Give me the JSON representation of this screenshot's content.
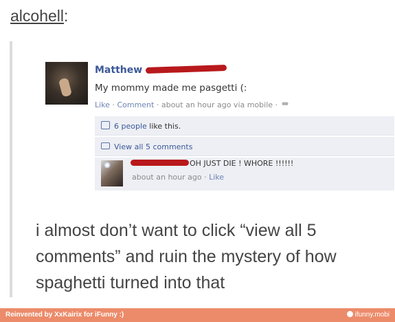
{
  "tumblr": {
    "username": "alcohell",
    "colon": ":"
  },
  "fb_post": {
    "poster_name": "Matthew",
    "status": "My mommy made me pasgetti (:",
    "meta": {
      "like": "Like",
      "sep1": " · ",
      "comment": "Comment",
      "sep2": " · ",
      "time": "about an hour ago via mobile",
      "sep3": " · "
    },
    "likes": {
      "people_link": "6 people",
      "suffix": " like this."
    },
    "view_all": "View all 5 comments",
    "comment": {
      "text": "OH JUST DIE ! WHORE !!!!!!",
      "time": "about an hour ago",
      "sep": " · ",
      "like": "Like"
    }
  },
  "caption": "i almost don’t want to click “view all 5 comments” and ruin the mystery of how spaghetti turned into that",
  "footer": {
    "left": "Reinvented by XxKairix for iFunny :)",
    "right": "ifunny.mobi"
  },
  "colors": {
    "fb_blue": "#3b5998",
    "fb_box": "#edeff4",
    "redaction": "#b8191c",
    "footer": "#ec8b6a"
  },
  "icons": [
    "people-icon",
    "thumbs-up-icon",
    "comment-bubble-icon",
    "ifunny-icon"
  ]
}
